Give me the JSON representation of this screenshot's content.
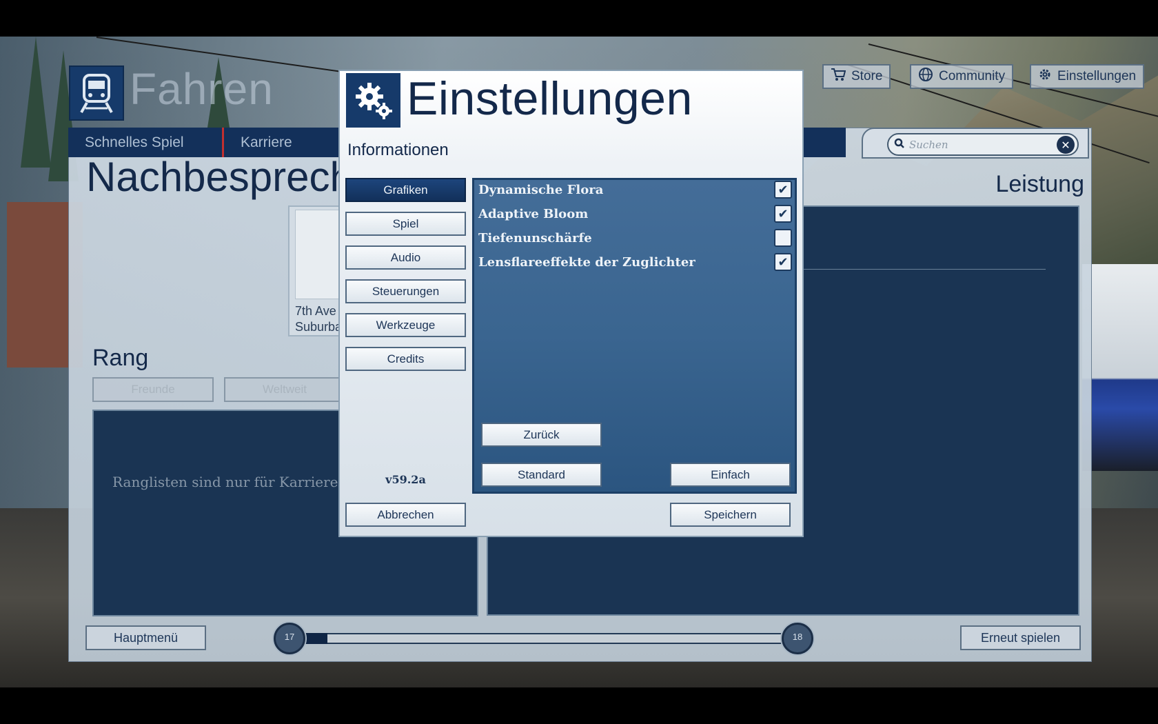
{
  "background": {
    "mode_title": "Fahren",
    "tabs": [
      {
        "label": "Schnelles Spiel"
      },
      {
        "label": "Karriere"
      }
    ],
    "search_placeholder": "Suchen",
    "top_buttons": {
      "store": "Store",
      "community": "Community",
      "settings": "Einstellungen"
    },
    "page_heading": "Nachbesprech",
    "performance_heading": "Leistung",
    "route_text_1": "7th Ave",
    "route_text_2": "Suburba",
    "rank_heading": "Rang",
    "rank_filter_friends": "Freunde",
    "rank_filter_world": "Weltweit",
    "rank_message": "Ranglisten sind nur für Karriere Sz",
    "main_menu_button": "Hauptmenü",
    "replay_button": "Erneut spielen",
    "level_current": "17",
    "level_next": "18",
    "level_progress_fraction": 0.05
  },
  "modal": {
    "title": "Einstellungen",
    "subtitle": "Informationen",
    "nav": [
      {
        "label": "Grafiken",
        "active": true
      },
      {
        "label": "Spiel",
        "active": false
      },
      {
        "label": "Audio",
        "active": false
      },
      {
        "label": "Steuerungen",
        "active": false
      },
      {
        "label": "Werkzeuge",
        "active": false
      },
      {
        "label": "Credits",
        "active": false
      }
    ],
    "version": "v59.2a",
    "options": [
      {
        "label": "Dynamische Flora",
        "checked": true
      },
      {
        "label": "Adaptive Bloom",
        "checked": true
      },
      {
        "label": "Tiefenunschärfe",
        "checked": false
      },
      {
        "label": "Lensflareeffekte der Zuglichter",
        "checked": true
      }
    ],
    "back_button": "Zurück",
    "default_button": "Standard",
    "simple_button": "Einfach",
    "cancel_button": "Abbrechen",
    "save_button": "Speichern"
  },
  "colors": {
    "accent_dark_blue": "#13284a",
    "panel_blue": "#3a6590",
    "active_nav": "#12305a"
  }
}
